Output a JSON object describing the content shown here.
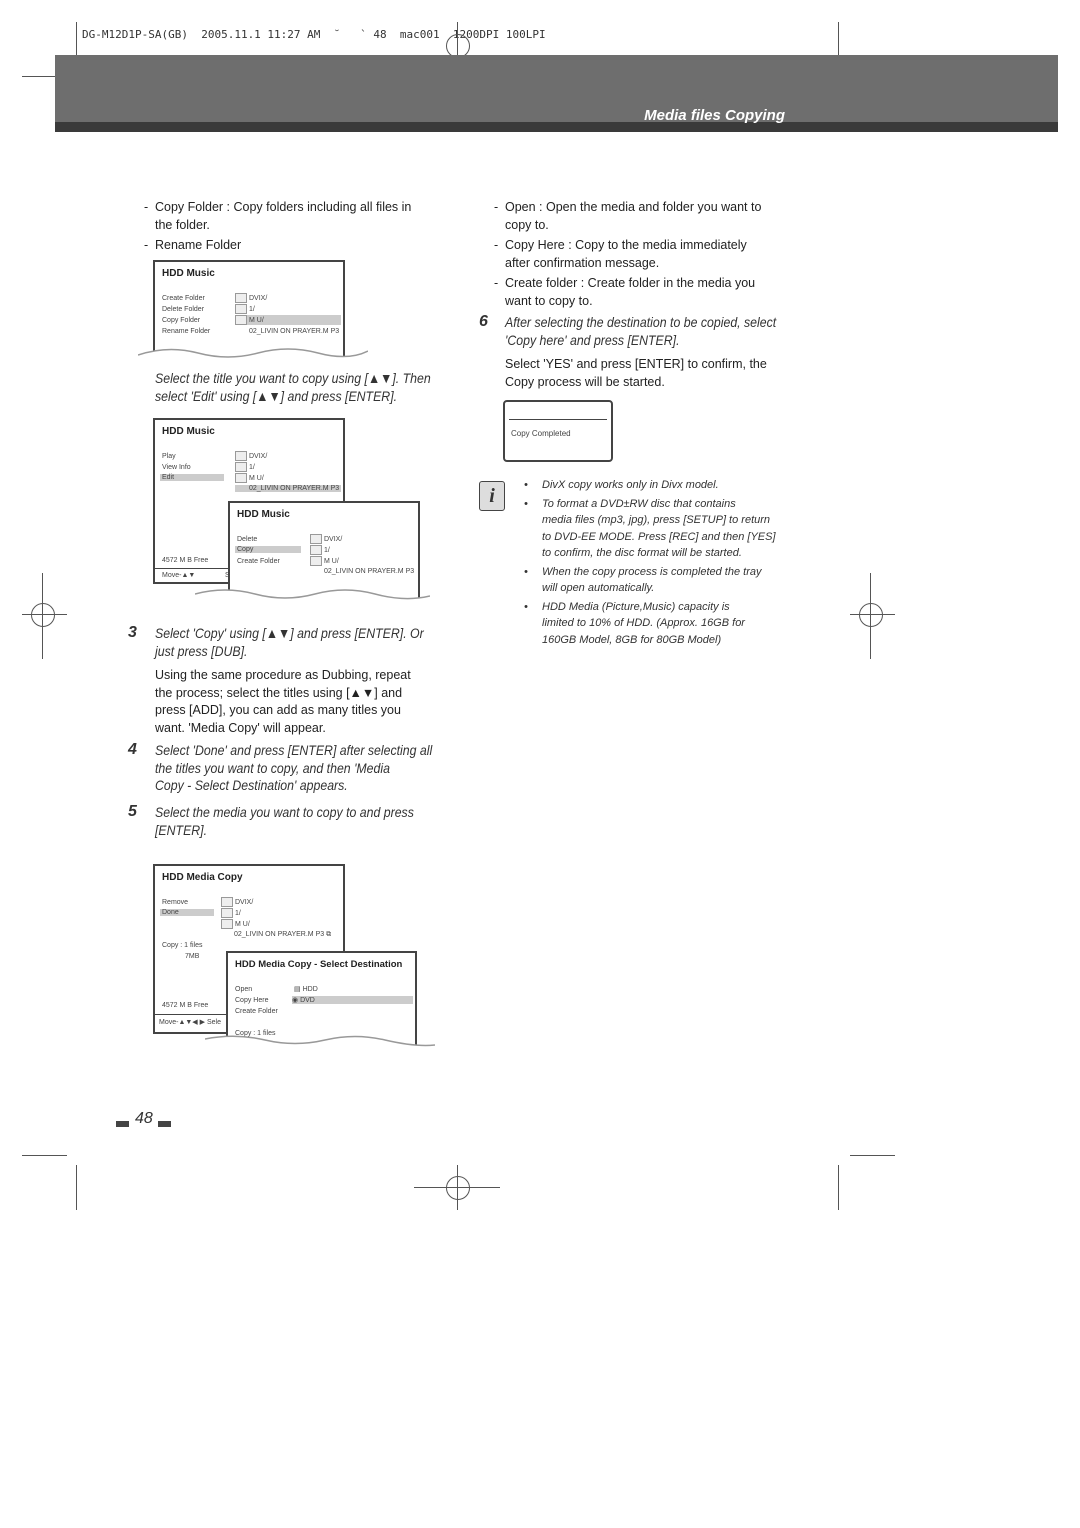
{
  "slug": "DG-M12D1P-SA(GB)  2005.11.1 11:27 AM  ˘   ` 48  mac001  1200DPI 100LPI",
  "section_title": "Media files Copying",
  "left": {
    "bullets": [
      "Copy Folder : Copy folders including all files in",
      "the folder.",
      "Rename Folder"
    ],
    "screen1": {
      "title": "HDD Music",
      "menu": [
        "Create Folder",
        "Delete Folder",
        "Copy  Folder",
        "Rename Folder"
      ],
      "files": [
        "DVIX/",
        "1/",
        "M U/",
        "02_LIVIN ON PRAYER.M P3"
      ]
    },
    "instr1": [
      "Select the title you want to copy using [▲▼]. Then",
      "select 'Edit' using  [▲▼] and press [ENTER]."
    ],
    "screen2": {
      "title": "HDD Music",
      "menu": [
        "Play",
        "View Info",
        "Edit"
      ],
      "files": [
        "DVIX/",
        "1/",
        "M U/",
        "02_LIVIN ON PRAYER.M P3"
      ],
      "free": "4572 M B Free",
      "move": "Move-▲▼",
      "sel": "S"
    },
    "screen3": {
      "title": "HDD Music",
      "menu": [
        "Delete",
        "Copy",
        "Create Folder"
      ],
      "files": [
        "DVIX/",
        "1/",
        "M U/",
        "02_LIVIN ON PRAYER.M P3"
      ]
    },
    "step3": {
      "num": "3",
      "head": [
        "Select 'Copy' using  [▲▼] and press [ENTER]. Or",
        "just press [DUB]."
      ],
      "body": [
        "Using the same procedure as Dubbing, repeat",
        "the process; select the titles using [▲▼] and",
        "press [ADD], you can add as many titles you",
        "want. 'Media Copy' will appear."
      ]
    },
    "step4": {
      "num": "4",
      "head": [
        "Select 'Done' and press [ENTER] after selecting all",
        "the titles you want to copy, and then 'Media",
        "Copy - Select Destination' appears."
      ]
    },
    "step5": {
      "num": "5",
      "head": [
        "Select the media you want to copy to and press",
        "[ENTER]."
      ]
    },
    "screen4": {
      "title": "HDD Media Copy",
      "menu": [
        "Remove",
        "Done"
      ],
      "files": [
        "DVIX/",
        "1/",
        "M U/",
        "02_LIVIN ON PRAYER.M P3"
      ],
      "copy": "Copy : 1 files",
      "size": "7MB",
      "free": "4572 M B Free",
      "move": "Move-▲▼◀ ▶  Sele"
    },
    "screen5": {
      "title": "HDD Media Copy - Select Destination",
      "menu": [
        "Open",
        "Copy Here",
        "Create Folder"
      ],
      "dest": [
        "HDD",
        "DVD"
      ],
      "copy": "Copy : 1 files"
    }
  },
  "right": {
    "bullets": [
      [
        "Open : Open the media and folder you want to",
        "copy to."
      ],
      [
        "Copy Here : Copy to the media immediately",
        "after confirmation message."
      ],
      [
        "Create folder : Create folder in the media you",
        "want to copy to."
      ]
    ],
    "step6": {
      "num": "6",
      "head": [
        "After selecting the destination to be copied, select",
        "'Copy here' and press [ENTER]."
      ],
      "body": [
        "Select 'YES' and press [ENTER] to confirm, the",
        "Copy process will be started."
      ]
    },
    "dialog": "Copy Completed",
    "notes": [
      [
        "DivX copy works only in Divx model."
      ],
      [
        "To format a DVD±RW disc that contains",
        "media files (mp3, jpg), press [SETUP] to return",
        "to DVD-EE MODE. Press [REC] and then [YES]",
        "to confirm, the disc format will be started."
      ],
      [
        "When the copy process is completed the tray",
        "will open automatically."
      ],
      [
        "HDD Media (Picture,Music) capacity is",
        "limited to 10% of HDD. (Approx. 16GB for",
        "160GB Model, 8GB for 80GB Model)"
      ]
    ]
  },
  "page_number": "48"
}
